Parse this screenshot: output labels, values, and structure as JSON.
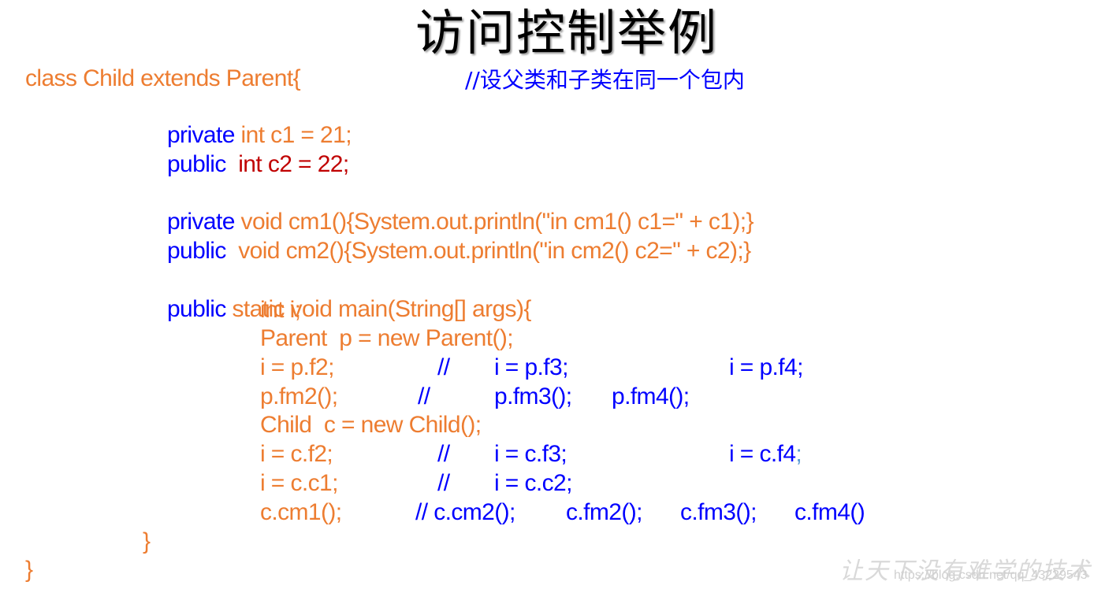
{
  "title": "访问控制举例",
  "colors": {
    "orange": "#ED7D31",
    "blue": "#0000FF",
    "dark_red": "#C00000",
    "light_blue": "#5B9BD5"
  },
  "code": {
    "line1": "class Child extends Parent{",
    "line1_comment": "//设父类和子类在同一个包内",
    "line2_kw": "private",
    "line2_rest": " int c1 = 21;",
    "line3_kw": "public",
    "line3_rest": "  int c2 = 22;",
    "line4_kw": "private",
    "line4_rest": " void cm1(){System.out.println(\"in cm1() c1=\" + c1);}",
    "line5_kw": "public",
    "line5_rest": "  void cm2(){System.out.println(\"in cm2() c2=\" + c2);}",
    "line6_kw": "public",
    "line6_rest": " static void main(String[] args){",
    "line7": "int i;",
    "line8": "Parent  p = new Parent();",
    "line9": {
      "a": "i = p.f2;",
      "b": "//",
      "c": "i = p.f3;",
      "d": "i = p.f4;"
    },
    "line10": {
      "a": "p.fm2();",
      "b": "//",
      "c": "p.fm3();",
      "d": "p.fm4();"
    },
    "line11": "Child  c = new Child();",
    "line12": {
      "a": "i = c.f2;",
      "b": "//",
      "c": "i = c.f3;",
      "d": "i = c.f4",
      "e": ";"
    },
    "line13": {
      "a": "i = c.c1;",
      "b": "//",
      "c": "i = c.c2;"
    },
    "line14": {
      "a": "c.cm1();",
      "b": "// c.cm2();",
      "c": "c.fm2();",
      "d": "c.fm3();",
      "e": "c.fm4()"
    },
    "close_main": "}",
    "close_class": "}"
  },
  "watermark": {
    "slogan": "让天下没有难学的技术",
    "url": "https://blog.csdn.net/qq_43229543"
  }
}
